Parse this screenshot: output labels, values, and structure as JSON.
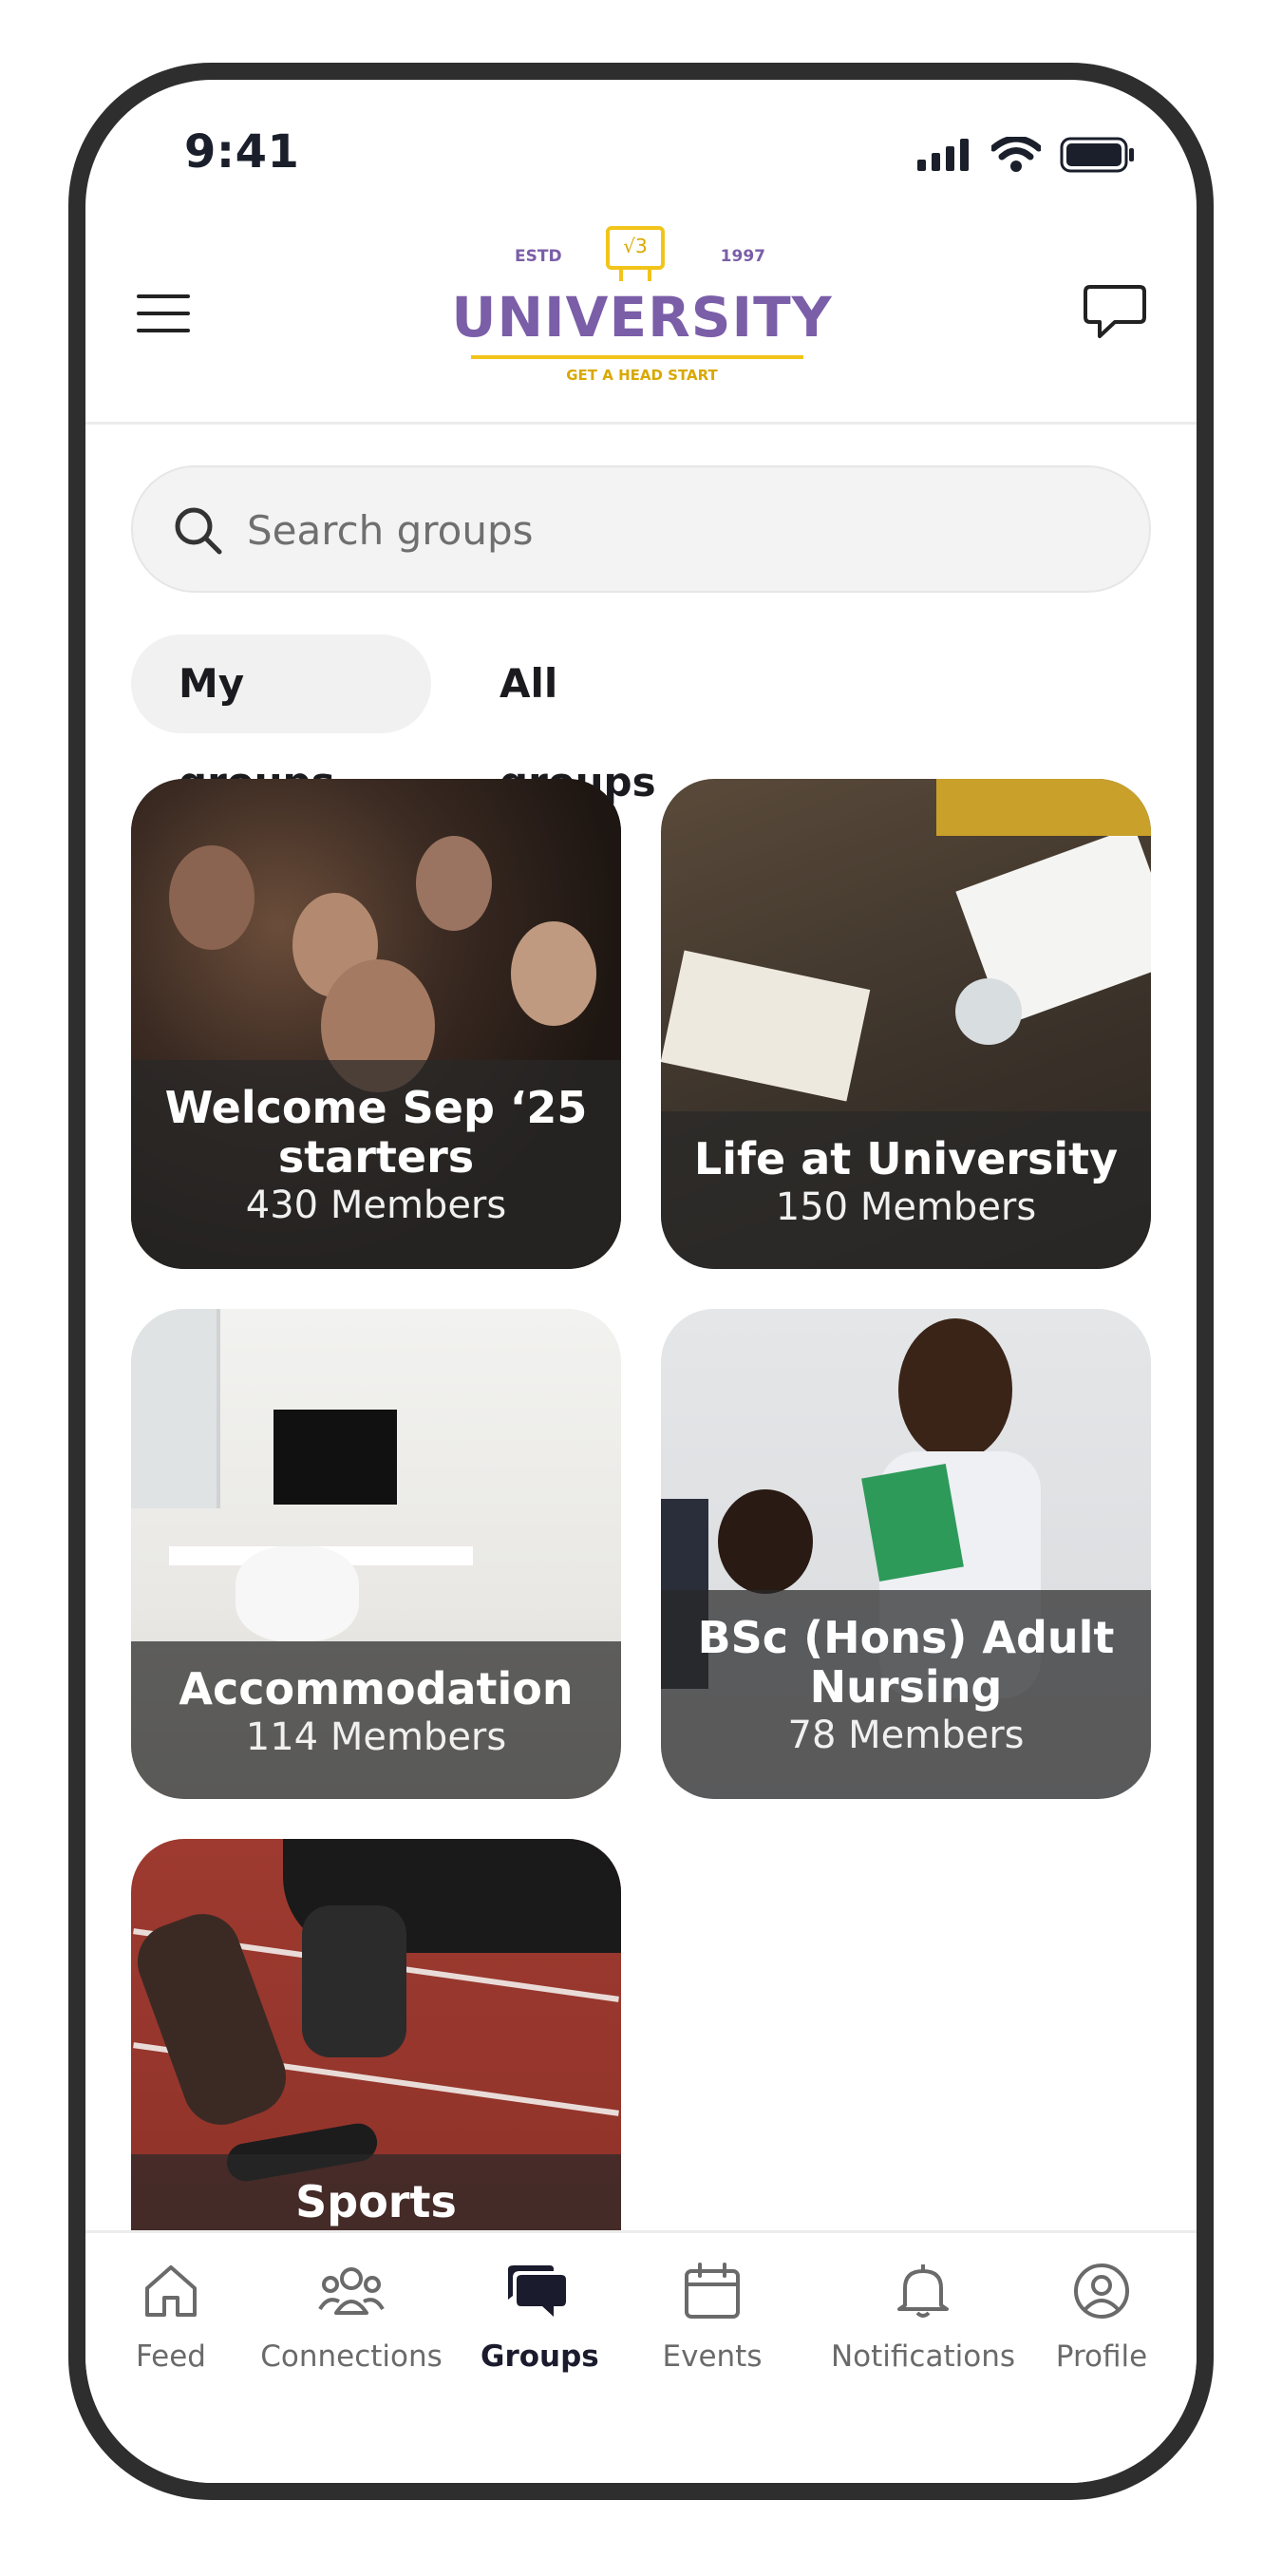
{
  "status_bar": {
    "time": "9:41"
  },
  "header": {
    "logo": {
      "estd": "ESTD",
      "symbol": "√3",
      "year": "1997",
      "name": "UNIVERSITY",
      "tagline": "GET A HEAD START"
    }
  },
  "search": {
    "placeholder": "Search groups"
  },
  "tabs": [
    {
      "label": "My groups",
      "active": true
    },
    {
      "label": "All groups",
      "active": false
    }
  ],
  "groups": [
    {
      "title": "Welcome Sep ‘25 starters",
      "members": "430 Members"
    },
    {
      "title": "Life at University",
      "members": "150 Members"
    },
    {
      "title": "Accommodation",
      "members": "114 Members"
    },
    {
      "title": "BSc (Hons) Adult Nursing",
      "members": "78 Members"
    },
    {
      "title": "Sports",
      "members": ""
    }
  ],
  "bottom_nav": [
    {
      "label": "Feed",
      "icon": "home-icon"
    },
    {
      "label": "Connections",
      "icon": "people-icon"
    },
    {
      "label": "Groups",
      "icon": "chat-bubbles-icon",
      "active": true
    },
    {
      "label": "Events",
      "icon": "calendar-icon"
    },
    {
      "label": "Notifications",
      "icon": "bell-icon"
    },
    {
      "label": "Profile",
      "icon": "user-circle-icon"
    }
  ],
  "colors": {
    "brand_purple": "#7b5ea8",
    "brand_yellow": "#f2c41a",
    "active_nav": "#1b1b2e"
  }
}
